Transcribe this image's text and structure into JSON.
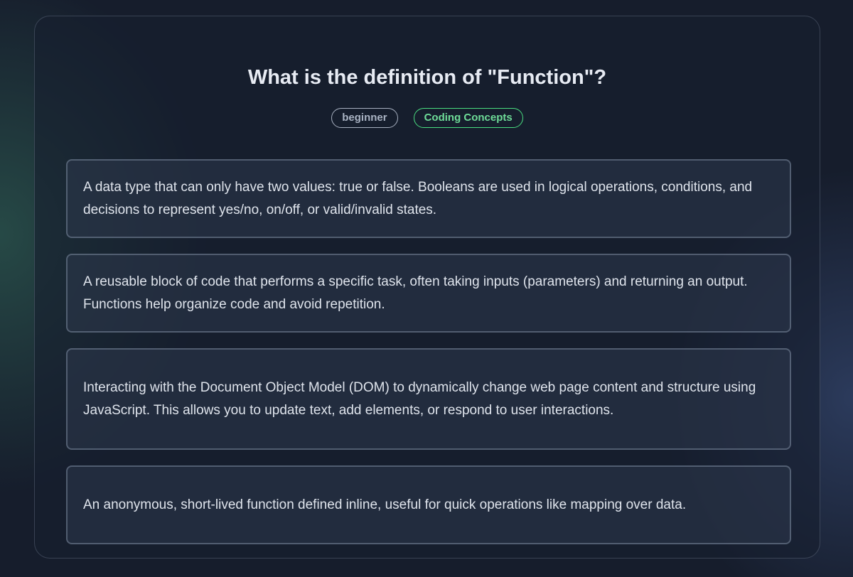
{
  "quiz": {
    "question": "What is the definition of \"Function\"?",
    "tags": {
      "difficulty": "beginner",
      "category": "Coding Concepts"
    },
    "options": [
      "A data type that can only have two values: true or false. Booleans are used in logical operations, conditions, and decisions to represent yes/no, on/off, or valid/invalid states.",
      "A reusable block of code that performs a specific task, often taking inputs (parameters) and returning an output. Functions help organize code and avoid repetition.",
      "Interacting with the Document Object Model (DOM) to dynamically change web page content and structure using JavaScript. This allows you to update text, add elements, or respond to user interactions.",
      "An anonymous, short-lived function defined inline, useful for quick operations like mapping over data."
    ]
  },
  "colors": {
    "background": "#161d2c",
    "accent_green": "#4ade80",
    "text_primary": "#e7ebf3",
    "tag_neutral": "#a7b0c0"
  }
}
